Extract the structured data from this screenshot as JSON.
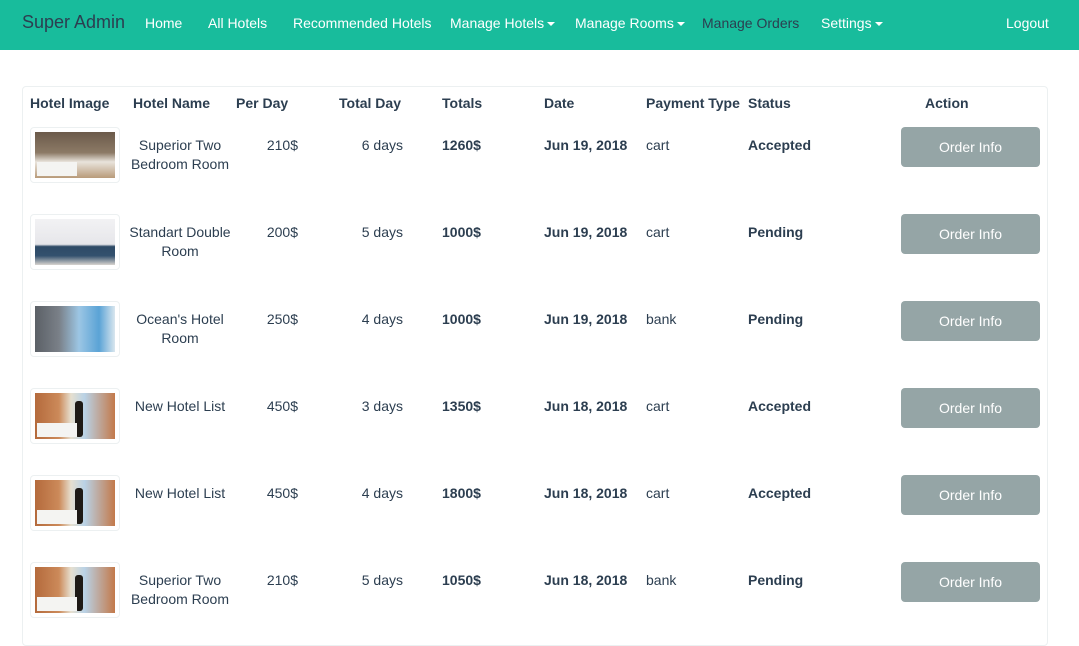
{
  "nav": {
    "brand": "Super Admin",
    "links": [
      "Home",
      "All Hotels",
      "Recommended Hotels",
      "Manage Hotels",
      "Manage Rooms",
      "Manage Orders",
      "Settings"
    ],
    "logout": "Logout"
  },
  "table": {
    "headers": [
      "Hotel Image",
      "Hotel Name",
      "Per Day",
      "Total Day",
      "Totals",
      "Date",
      "Payment Type",
      "Status",
      "Action"
    ],
    "rows": [
      {
        "image": "bedroom",
        "name": "Superior Two Bedroom Room",
        "per_day": "210$",
        "total_day": "6 days",
        "totals": "1260$",
        "date": "Jun 19, 2018",
        "payment": "cart",
        "status": "Accepted",
        "action": "Order Info"
      },
      {
        "image": "sofa",
        "name": "Standart Double Room",
        "per_day": "200$",
        "total_day": "5 days",
        "totals": "1000$",
        "date": "Jun 19, 2018",
        "payment": "cart",
        "status": "Pending",
        "action": "Order Info"
      },
      {
        "image": "ocean",
        "name": "Ocean's Hotel Room",
        "per_day": "250$",
        "total_day": "4 days",
        "totals": "1000$",
        "date": "Jun 19, 2018",
        "payment": "bank",
        "status": "Pending",
        "action": "Order Info"
      },
      {
        "image": "window",
        "name": "New Hotel List",
        "per_day": "450$",
        "total_day": "3 days",
        "totals": "1350$",
        "date": "Jun 18, 2018",
        "payment": "cart",
        "status": "Accepted",
        "action": "Order Info"
      },
      {
        "image": "window",
        "name": "New Hotel List",
        "per_day": "450$",
        "total_day": "4 days",
        "totals": "1800$",
        "date": "Jun 18, 2018",
        "payment": "cart",
        "status": "Accepted",
        "action": "Order Info"
      },
      {
        "image": "window",
        "name": "Superior Two Bedroom Room",
        "per_day": "210$",
        "total_day": "5 days",
        "totals": "1050$",
        "date": "Jun 18, 2018",
        "payment": "bank",
        "status": "Pending",
        "action": "Order Info"
      }
    ]
  },
  "colors": {
    "navbar": "#18bc9c",
    "text": "#2c3e50",
    "button": "#95a5a6"
  }
}
